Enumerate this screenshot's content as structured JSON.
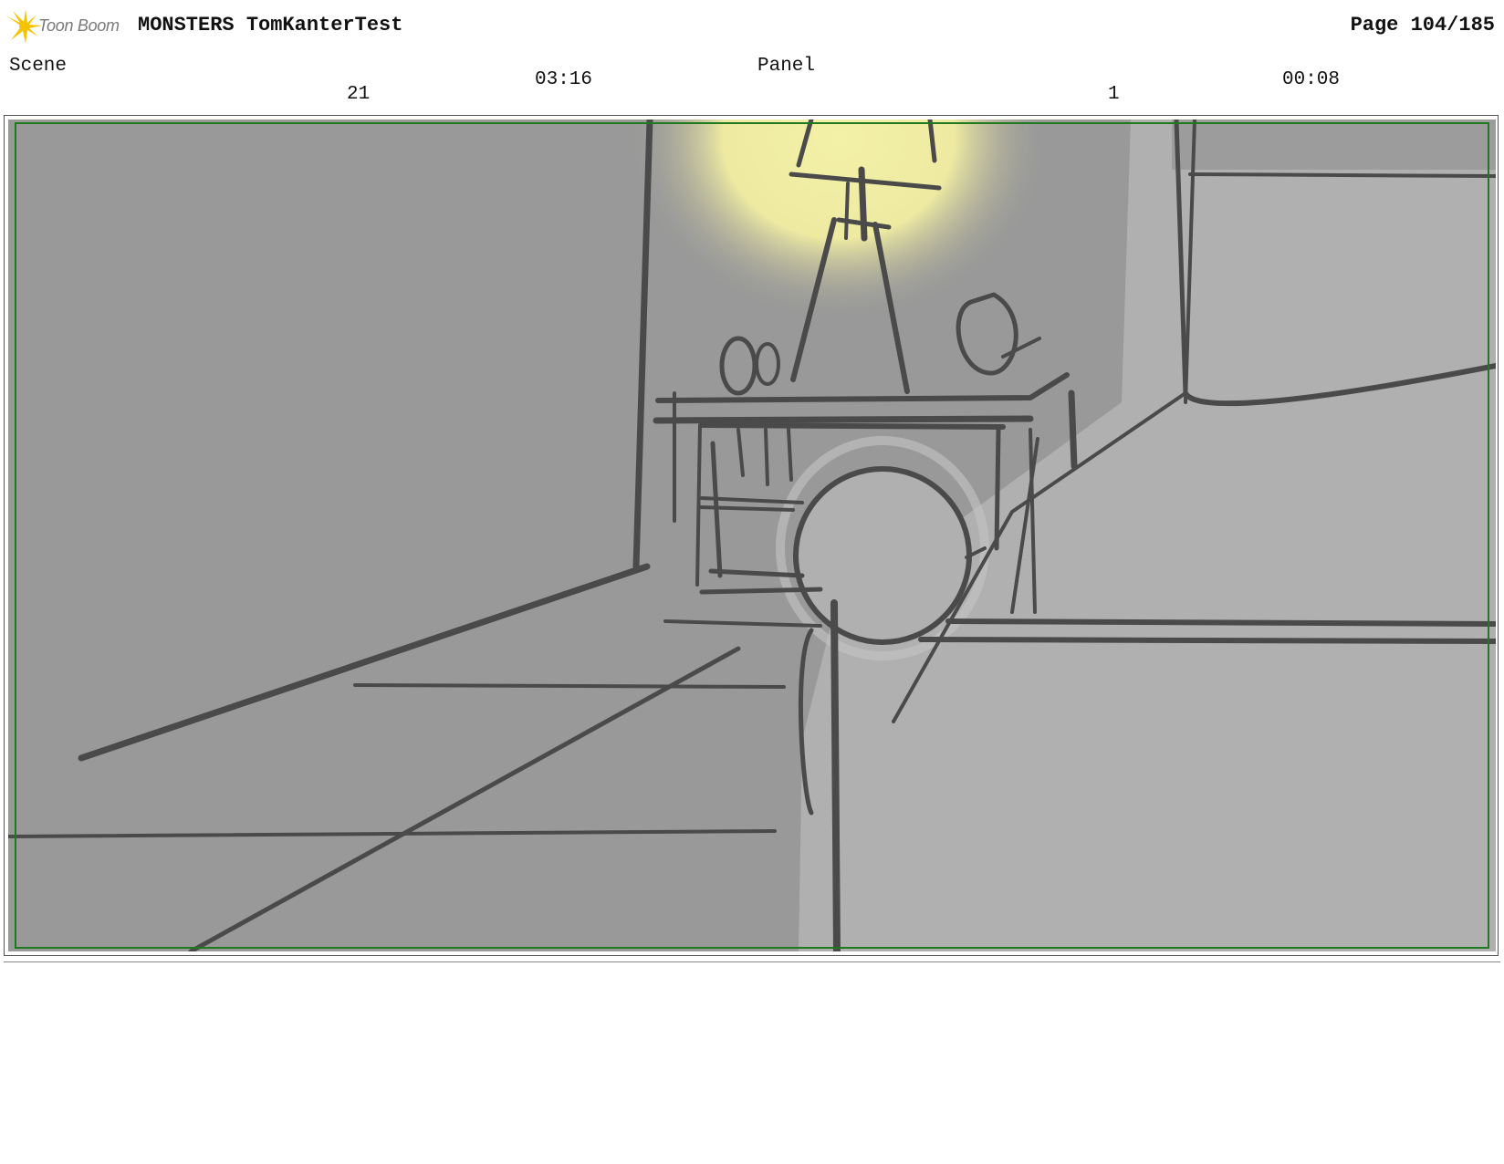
{
  "header": {
    "logo_text": "Toon Boom",
    "logo_color": "#f5c400",
    "project_title": "MONSTERS TomKanterTest",
    "page_number": "Page 104/185"
  },
  "scene": {
    "label": "Scene",
    "value": "21",
    "duration": "03:16"
  },
  "panel": {
    "label": "Panel",
    "value": "1",
    "duration": "00:08"
  },
  "colors": {
    "safe_frame": "#1f7a1f",
    "sketch_line": "#4a4a4a",
    "background_wall": "#999999",
    "light_glow": "#f3f0a8"
  }
}
